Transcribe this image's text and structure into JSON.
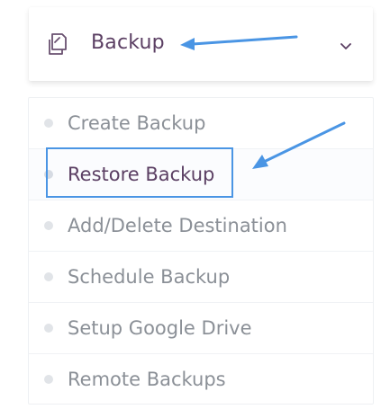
{
  "menu": {
    "title": "Backup",
    "items": [
      {
        "label": "Create Backup"
      },
      {
        "label": "Restore Backup"
      },
      {
        "label": "Add/Delete Destination"
      },
      {
        "label": "Schedule Backup"
      },
      {
        "label": "Setup Google Drive"
      },
      {
        "label": "Remote Backups"
      }
    ],
    "active_item": "Restore Backup"
  },
  "icons": {
    "header": "copy-icon",
    "toggle": "chevron-down-icon"
  },
  "colors": {
    "title_text": "#5b3f63",
    "item_text": "#8b9097",
    "annotation": "#4a95e4",
    "bullet": "#e1e4e8"
  }
}
